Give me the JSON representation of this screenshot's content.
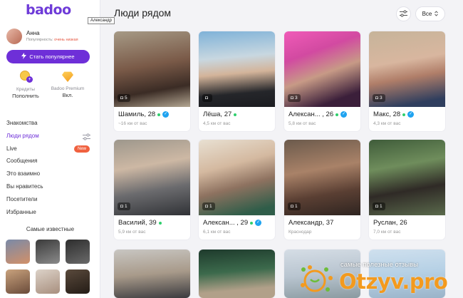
{
  "app": {
    "logo": "badoo",
    "tooltip": "Александр"
  },
  "user": {
    "name": "Анна",
    "popularity_label": "Популярность:",
    "popularity_value": "очень низкая"
  },
  "sidebar": {
    "popular_button": "Стать популярнее",
    "credits": {
      "label": "Кредиты",
      "action": "Пополнить"
    },
    "premium": {
      "label": "Badoo Premium",
      "action": "Вкл."
    },
    "nav": [
      {
        "label": "Знакомства"
      },
      {
        "label": "Люди рядом"
      },
      {
        "label": "Live",
        "badge": "New"
      },
      {
        "label": "Сообщения"
      },
      {
        "label": "Это взаимно"
      },
      {
        "label": "Вы нравитесь"
      },
      {
        "label": "Посетители"
      },
      {
        "label": "Избранные"
      }
    ],
    "famous_title": "Самые известные"
  },
  "main": {
    "title": "Люди рядом",
    "filter_select": "Все",
    "people": [
      {
        "name": "Шамиль, 28",
        "distance": "~16 км от вас",
        "photos": "5",
        "online": true,
        "verified": true
      },
      {
        "name": "Лёша, 27",
        "distance": "4,5 км от вас",
        "photos": "",
        "online": true,
        "verified": false
      },
      {
        "name": "Алексан... , 26",
        "distance": "5,8 км от вас",
        "photos": "3",
        "online": true,
        "verified": true
      },
      {
        "name": "Макс, 28",
        "distance": "4,3 км от вас",
        "photos": "3",
        "online": true,
        "verified": true
      },
      {
        "name": "Василий, 39",
        "distance": "5,9 км от вас",
        "photos": "1",
        "online": true,
        "verified": false
      },
      {
        "name": "Алексан... , 29",
        "distance": "6,1 км от вас",
        "photos": "1",
        "online": true,
        "verified": true
      },
      {
        "name": "Александр, 37",
        "distance": "Краснодар",
        "photos": "1",
        "online": false,
        "verified": false
      },
      {
        "name": "Руслан, 26",
        "distance": "7,0 км от вас",
        "photos": "1",
        "online": false,
        "verified": false
      }
    ]
  },
  "watermark": {
    "text": "самые полезные отзывы",
    "brand": "Otzyv.pro"
  },
  "colors": {
    "accent": "#6e2fd8",
    "online": "#2fcf6d",
    "verified": "#1fa3f0",
    "new_badge": "#f0613f",
    "brand_orange": "#f39a1e"
  }
}
